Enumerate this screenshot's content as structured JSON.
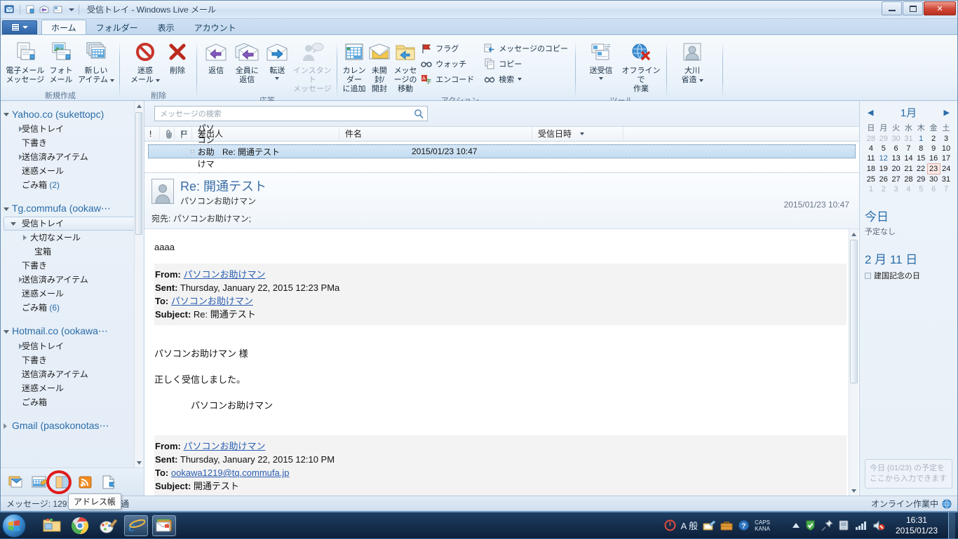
{
  "window": {
    "title": "受信トレイ - Windows Live メール",
    "quick_access": [
      "app-icon",
      "new-mail-icon",
      "reply-icon",
      "send-receive-icon",
      "customize-caret"
    ],
    "controls": {
      "minimize": "—",
      "restore": "❐",
      "close": "✕"
    }
  },
  "ribbon": {
    "tabs": [
      {
        "label": "ホーム",
        "active": true
      },
      {
        "label": "フォルダー",
        "active": false
      },
      {
        "label": "表示",
        "active": false
      },
      {
        "label": "アカウント",
        "active": false
      }
    ],
    "groups": [
      {
        "label": "新規作成",
        "buttons": [
          {
            "label": "電子メール\nメッセージ",
            "line1": "電子メール",
            "line2": "メッセージ",
            "icon": "new-email-icon",
            "dimmed": false,
            "caret": false
          },
          {
            "label": "フォト\nメール",
            "line1": "フォト",
            "line2": "メール",
            "icon": "photo-mail-icon",
            "dimmed": false,
            "caret": false
          },
          {
            "label": "新しい\nアイテム",
            "line1": "新しい",
            "line2": "アイテム",
            "icon": "new-item-icon",
            "dimmed": false,
            "caret": true
          }
        ]
      },
      {
        "label": "削除",
        "buttons": [
          {
            "line1": "迷惑",
            "line2": "メール",
            "icon": "junk-mail-icon",
            "dimmed": false,
            "caret": true
          },
          {
            "line1": "削除",
            "line2": "",
            "icon": "delete-icon",
            "dimmed": false,
            "caret": false
          }
        ]
      },
      {
        "label": "応答",
        "buttons": [
          {
            "line1": "返信",
            "line2": "",
            "icon": "reply-icon",
            "dimmed": false,
            "caret": false
          },
          {
            "line1": "全員に",
            "line2": "返信",
            "icon": "reply-all-icon",
            "dimmed": false,
            "caret": false
          },
          {
            "line1": "転送",
            "line2": "",
            "icon": "forward-icon",
            "dimmed": false,
            "caret": true
          },
          {
            "line1": "インスタント",
            "line2": "メッセージ",
            "icon": "instant-message-icon",
            "dimmed": true,
            "caret": false
          }
        ]
      },
      {
        "label": "アクション",
        "buttons": [
          {
            "line1": "カレンダー",
            "line2": "に追加",
            "icon": "add-to-calendar-icon",
            "dimmed": false,
            "caret": false
          },
          {
            "line1": "未開封/",
            "line2": "開封",
            "icon": "mark-unread-icon",
            "dimmed": false,
            "caret": false
          },
          {
            "line1": "メッセージの",
            "line2": "移動",
            "icon": "move-message-icon",
            "dimmed": false,
            "caret": false
          }
        ],
        "small_col1": [
          {
            "label": "フラグ",
            "icon": "flag-icon"
          },
          {
            "label": "ウォッチ",
            "icon": "watch-icon"
          },
          {
            "label": "エンコード",
            "icon": "encode-icon"
          }
        ],
        "small_col2": [
          {
            "label": "メッセージのコピー",
            "icon": "copy-message-icon"
          },
          {
            "label": "コピー",
            "icon": "copy-icon"
          },
          {
            "label": "検索",
            "icon": "find-icon",
            "caret": true
          }
        ]
      },
      {
        "label": "ツール",
        "buttons": [
          {
            "line1": "送受信",
            "line2": "",
            "icon": "send-receive-icon",
            "dimmed": false,
            "caret": true
          },
          {
            "line1": "オフラインで",
            "line2": "作業",
            "icon": "work-offline-icon",
            "dimmed": false,
            "caret": false
          }
        ]
      },
      {
        "label": "",
        "buttons": [
          {
            "line1": "大川",
            "line2": "省造",
            "icon": "user-account-icon",
            "dimmed": false,
            "caret": true
          }
        ]
      }
    ]
  },
  "sidebar": {
    "accounts": [
      {
        "name": "Yahoo.co (sukettopc)",
        "expanded": true,
        "folders": [
          {
            "label": "受信トレイ",
            "arrow": true,
            "count": "",
            "selected": false,
            "indent": 0
          },
          {
            "label": "下書き",
            "arrow": false,
            "count": "",
            "selected": false,
            "indent": 0
          },
          {
            "label": "送信済みアイテム",
            "arrow": true,
            "count": "",
            "selected": false,
            "indent": 0
          },
          {
            "label": "迷惑メール",
            "arrow": false,
            "count": "",
            "selected": false,
            "indent": 0
          },
          {
            "label": "ごみ箱",
            "arrow": false,
            "count": "(2)",
            "selected": false,
            "indent": 0
          }
        ]
      },
      {
        "name": "Tg.commufa (ookaw⋯",
        "expanded": true,
        "folders": [
          {
            "label": "受信トレイ",
            "arrow": true,
            "count": "",
            "selected": true,
            "indent": 0
          },
          {
            "label": "大切なメール",
            "arrow": true,
            "count": "",
            "selected": false,
            "indent": 1
          },
          {
            "label": "宝箱",
            "arrow": false,
            "count": "",
            "selected": false,
            "indent": 2
          },
          {
            "label": "下書き",
            "arrow": false,
            "count": "",
            "selected": false,
            "indent": 0
          },
          {
            "label": "送信済みアイテム",
            "arrow": true,
            "count": "",
            "selected": false,
            "indent": 0
          },
          {
            "label": "迷惑メール",
            "arrow": false,
            "count": "",
            "selected": false,
            "indent": 0
          },
          {
            "label": "ごみ箱",
            "arrow": false,
            "count": "(6)",
            "selected": false,
            "indent": 0
          }
        ]
      },
      {
        "name": "Hotmail.co (ookawa⋯",
        "expanded": true,
        "folders": [
          {
            "label": "受信トレイ",
            "arrow": true,
            "count": "",
            "selected": false,
            "indent": 0
          },
          {
            "label": "下書き",
            "arrow": false,
            "count": "",
            "selected": false,
            "indent": 0
          },
          {
            "label": "送信済みアイテム",
            "arrow": false,
            "count": "",
            "selected": false,
            "indent": 0
          },
          {
            "label": "迷惑メール",
            "arrow": false,
            "count": "",
            "selected": false,
            "indent": 0
          },
          {
            "label": "ごみ箱",
            "arrow": false,
            "count": "",
            "selected": false,
            "indent": 0
          }
        ]
      },
      {
        "name": "Gmail (pasokonotas⋯",
        "expanded": false,
        "folders": []
      }
    ],
    "shortcuts": [
      {
        "icon": "mail-shortcut-icon",
        "highlighted": false
      },
      {
        "icon": "calendar-shortcut-icon",
        "highlighted": false
      },
      {
        "icon": "address-book-shortcut-icon",
        "highlighted": true
      },
      {
        "icon": "feeds-shortcut-icon",
        "highlighted": false
      },
      {
        "icon": "newsgroups-shortcut-icon",
        "highlighted": false
      }
    ],
    "tooltip": "アドレス帳"
  },
  "search": {
    "placeholder": "メッセージの検索",
    "icon": "search-icon"
  },
  "message_list": {
    "columns": [
      {
        "label": "!",
        "name": "priority"
      },
      {
        "label": "",
        "name": "attachment"
      },
      {
        "label": "",
        "name": "flag"
      },
      {
        "label": "差出人",
        "name": "from"
      },
      {
        "label": "件名",
        "name": "subject"
      },
      {
        "label": "受信日時",
        "name": "received",
        "sorted": true
      }
    ],
    "rows": [
      {
        "from": "パソコンお助けマン",
        "subject": "Re: 開通テスト",
        "received": "2015/01/23 10:47",
        "selected": true,
        "icon": "envelope-open-icon"
      }
    ]
  },
  "preview": {
    "subject": "Re: 開通テスト",
    "from": "パソコンお助けマン",
    "date": "2015/01/23 10:47",
    "to_label": "宛先:",
    "to_value": "パソコンお助けマン;",
    "body": {
      "intro": "aaaa",
      "quote1": {
        "from_label": "From:",
        "from_value": "パソコンお助けマン",
        "sent_label": "Sent:",
        "sent_value": "Thursday, January 22, 2015 12:23 PMa",
        "to_label": "To:",
        "to_value": "パソコンお助けマン",
        "subject_label": "Subject:",
        "subject_value": "Re: 開通テスト"
      },
      "lines": [
        "パソコンお助けマン 様",
        "正しく受信しました。",
        "　　　　パソコンお助けマン"
      ],
      "quote2": {
        "from_label": "From:",
        "from_value": "パソコンお助けマン",
        "sent_label": "Sent:",
        "sent_value": "Thursday, January 22, 2015 12:10 PM",
        "to_label": "To:",
        "to_value": "ookawa1219@tq.commufa.jp",
        "subject_label": "Subject:",
        "subject_value": "開通テスト"
      }
    }
  },
  "calendar": {
    "prev_icon": "chevron-left-icon",
    "next_icon": "chevron-right-icon",
    "month": "1月",
    "weekdays": [
      "日",
      "月",
      "火",
      "水",
      "木",
      "金",
      "土"
    ],
    "weeks": [
      [
        {
          "d": "28",
          "s": "out"
        },
        {
          "d": "29",
          "s": "out"
        },
        {
          "d": "30",
          "s": "out"
        },
        {
          "d": "31",
          "s": "out"
        },
        {
          "d": "1",
          "s": "blu"
        },
        {
          "d": "2",
          "s": ""
        },
        {
          "d": "3",
          "s": ""
        }
      ],
      [
        {
          "d": "4",
          "s": ""
        },
        {
          "d": "5",
          "s": ""
        },
        {
          "d": "6",
          "s": ""
        },
        {
          "d": "7",
          "s": ""
        },
        {
          "d": "8",
          "s": ""
        },
        {
          "d": "9",
          "s": ""
        },
        {
          "d": "10",
          "s": ""
        }
      ],
      [
        {
          "d": "11",
          "s": ""
        },
        {
          "d": "12",
          "s": "blu"
        },
        {
          "d": "13",
          "s": ""
        },
        {
          "d": "14",
          "s": ""
        },
        {
          "d": "15",
          "s": ""
        },
        {
          "d": "16",
          "s": ""
        },
        {
          "d": "17",
          "s": ""
        }
      ],
      [
        {
          "d": "18",
          "s": ""
        },
        {
          "d": "19",
          "s": ""
        },
        {
          "d": "20",
          "s": ""
        },
        {
          "d": "21",
          "s": ""
        },
        {
          "d": "22",
          "s": ""
        },
        {
          "d": "23",
          "s": "today"
        },
        {
          "d": "24",
          "s": ""
        }
      ],
      [
        {
          "d": "25",
          "s": ""
        },
        {
          "d": "26",
          "s": ""
        },
        {
          "d": "27",
          "s": ""
        },
        {
          "d": "28",
          "s": ""
        },
        {
          "d": "29",
          "s": ""
        },
        {
          "d": "30",
          "s": ""
        },
        {
          "d": "31",
          "s": ""
        }
      ],
      [
        {
          "d": "1",
          "s": "out"
        },
        {
          "d": "2",
          "s": "out"
        },
        {
          "d": "3",
          "s": "out"
        },
        {
          "d": "4",
          "s": "out"
        },
        {
          "d": "5",
          "s": "out"
        },
        {
          "d": "6",
          "s": "out"
        },
        {
          "d": "7",
          "s": "out"
        }
      ]
    ],
    "today_heading": "今日",
    "today_sub": "予定なし",
    "next_heading": "2 月 11 日",
    "next_event": "建国記念の日",
    "appointment_placeholder": "今日 (01/23) の予定をここから入力できます"
  },
  "statusbar": {
    "left": "メッセージ: 1291",
    "left_suffix": "通",
    "right": "オンライン作業中",
    "right_icon": "globe-icon"
  },
  "taskbar": {
    "start_icon": "windows-start-orb",
    "items": [
      {
        "icon": "explorer-icon",
        "open": false
      },
      {
        "icon": "chrome-icon",
        "open": false
      },
      {
        "icon": "paint-icon",
        "open": false
      },
      {
        "icon": "internet-explorer-icon",
        "open": true
      },
      {
        "icon": "windows-live-mail-icon",
        "open": true
      }
    ],
    "tray": {
      "action_center_icon": "action-center-icon",
      "ime_mode": "A 般",
      "ime_icons": [
        "pencil-pad-icon",
        "toolbox-icon",
        "help-icon"
      ],
      "caps": "CAPS",
      "kana": "KANA",
      "overflow_icon": "show-hidden-icons-icon",
      "icons": [
        "security-shield-icon",
        "pin-icon",
        "device-icon",
        "network-icon",
        "volume-muted-icon"
      ],
      "time": "16:31",
      "date": "2015/01/23"
    }
  }
}
